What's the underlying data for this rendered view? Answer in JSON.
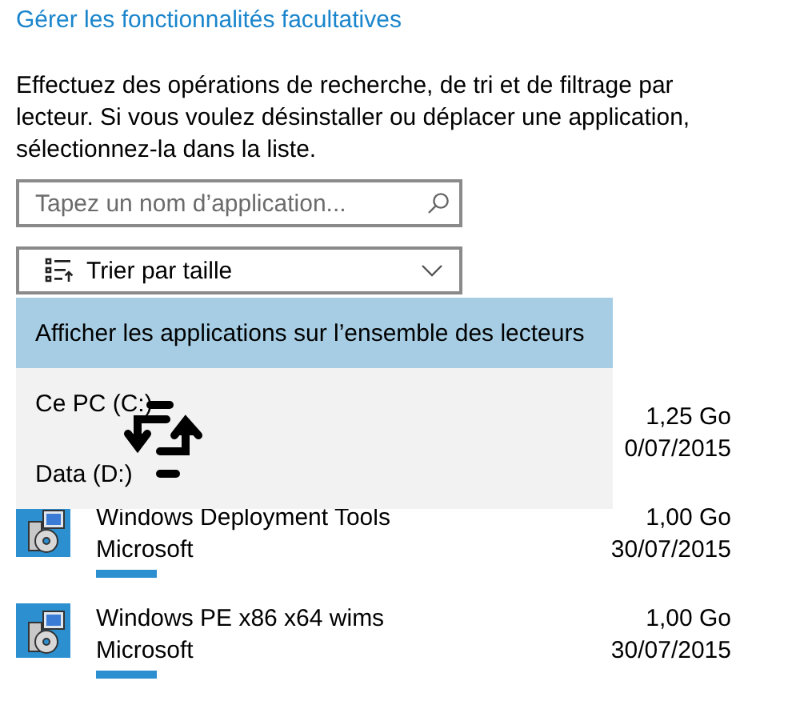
{
  "link": "Gérer les fonctionnalités facultatives",
  "description": "Effectuez des opérations de recherche, de tri et de filtrage par lecteur. Si vous voulez désinstaller ou déplacer une application, sélectionnez-la dans la liste.",
  "search": {
    "placeholder": "Tapez un nom d’application..."
  },
  "sort": {
    "label": "Trier par taille"
  },
  "drive_menu": [
    {
      "label": "Afficher les applications sur l’ensemble des lecteurs",
      "selected": true
    },
    {
      "label": "Ce PC (C:)",
      "selected": false
    },
    {
      "label": "Data (D:)",
      "selected": false
    }
  ],
  "apps": [
    {
      "kind": "hidden",
      "size": "1,25 Go",
      "date": "0/07/2015"
    },
    {
      "kind": "app",
      "name": "Windows Deployment Tools",
      "publisher": "Microsoft",
      "size": "1,00 Go",
      "date": "30/07/2015"
    },
    {
      "kind": "app",
      "name": "Windows PE x86 x64 wims",
      "publisher": "Microsoft",
      "size": "1,00 Go",
      "date": "30/07/2015"
    }
  ]
}
